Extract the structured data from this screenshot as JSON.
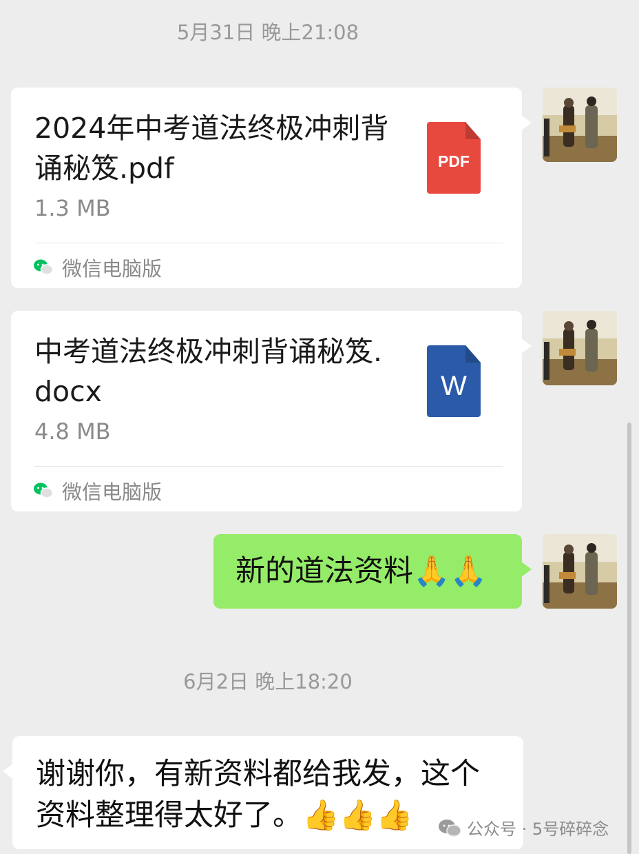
{
  "timestamps": [
    "5月31日 晚上21:08",
    "6月2日 晚上18:20"
  ],
  "messages": [
    {
      "file_name": "2024年中考道法终极冲刺背诵秘笈.pdf",
      "file_size": "1.3 MB",
      "icon_label": "PDF",
      "source": "微信电脑版"
    },
    {
      "file_name": "中考道法终极冲刺背诵秘笈.docx",
      "file_size": "4.8 MB",
      "icon_label": "W",
      "source": "微信电脑版"
    }
  ],
  "sent_text": "新的道法资料🙏🙏",
  "reply": {
    "line1": "谢谢你，有新资料都给我发，这个",
    "line2": "资料整理得太好了。👍👍👍"
  },
  "watermark": "公众号 · 5号碎碎念",
  "colors": {
    "background": "#ededed",
    "sent_bubble": "#95ec69",
    "pdf_icon": "#e8493f",
    "word_icon": "#2b5ba8",
    "wechat_green": "#07c160"
  }
}
